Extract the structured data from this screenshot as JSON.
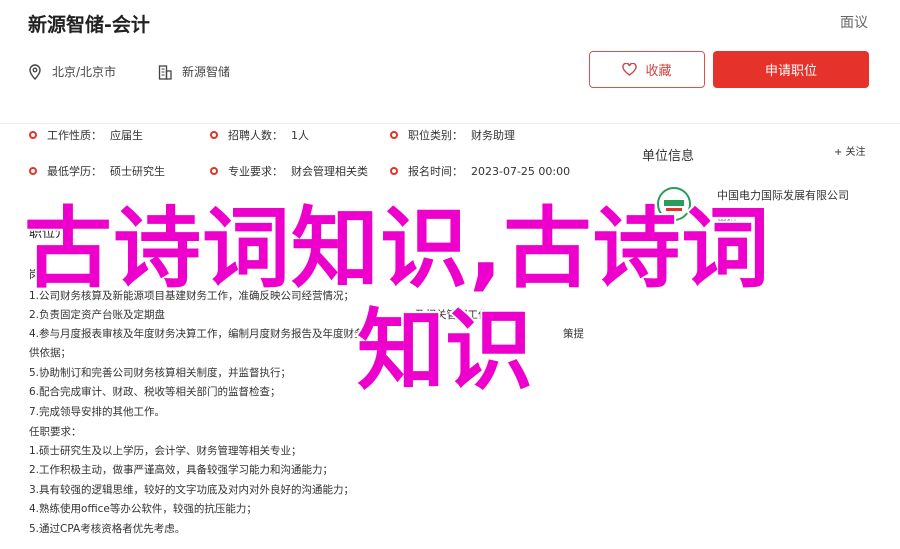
{
  "header": {
    "job_title": "新源智储-会计",
    "report": "面议",
    "location": "北京/北京市",
    "company": "新源智储",
    "favorite_label": "收藏",
    "apply_label": "申请职位"
  },
  "info": [
    {
      "k": "工作性质：",
      "v": "应届生"
    },
    {
      "k": "招聘人数：",
      "v": "1人"
    },
    {
      "k": "职位类别：",
      "v": "财务助理"
    },
    {
      "k": "最低学历：",
      "v": "硕士研究生"
    },
    {
      "k": "专业要求：",
      "v": "财会管理相关类"
    },
    {
      "k": "报名时间：",
      "v": "2023-07-25 00:00"
    }
  ],
  "section": {
    "title": "职位介",
    "duty_head": "岗"
  },
  "desc_lines": [
    "1.公司财务核算及新能源项目基建财务工作，准确反映公司经营情况；",
    "2.负责固定资产台账及定期盘",
    "4.参与月度报表审核及年度财务决算工作，编制月度财务报告及年度财务",
    "供依据；",
    "5.协助制订和完善公司财务核算相关制度，并监督执行；",
    "6.配合完成审计、财政、税收等相关部门的监督检查；",
    "7.完成领导安排的其他工作。",
    "任职要求：",
    "1.硕士研究生及以上学历，会计学、财务管理等相关专业；",
    "2.工作积极主动，做事严谨高效，具备较强学习能力和沟通能力；",
    "3.具有较强的逻辑思维，较好的文字功底及对内对外良好的沟通能力；",
    "4.熟练使用office等办公软件，较强的抗压能力；",
    "5.通过CPA考核资格者优先考虑。"
  ],
  "desc_line3_fragment": "及相关管理工作",
  "desc_line4_fragment": "策提",
  "company_panel": {
    "title": "单位信息",
    "follow": "+ 关注",
    "name": "中国电力国际发展有限公司",
    "tag": "单位",
    "size": "人"
  },
  "watermark": {
    "line1": "古诗词知识,古诗词",
    "line2": "知识"
  },
  "colors": {
    "accent": "#e5322b",
    "watermark": "#ee00cc"
  }
}
